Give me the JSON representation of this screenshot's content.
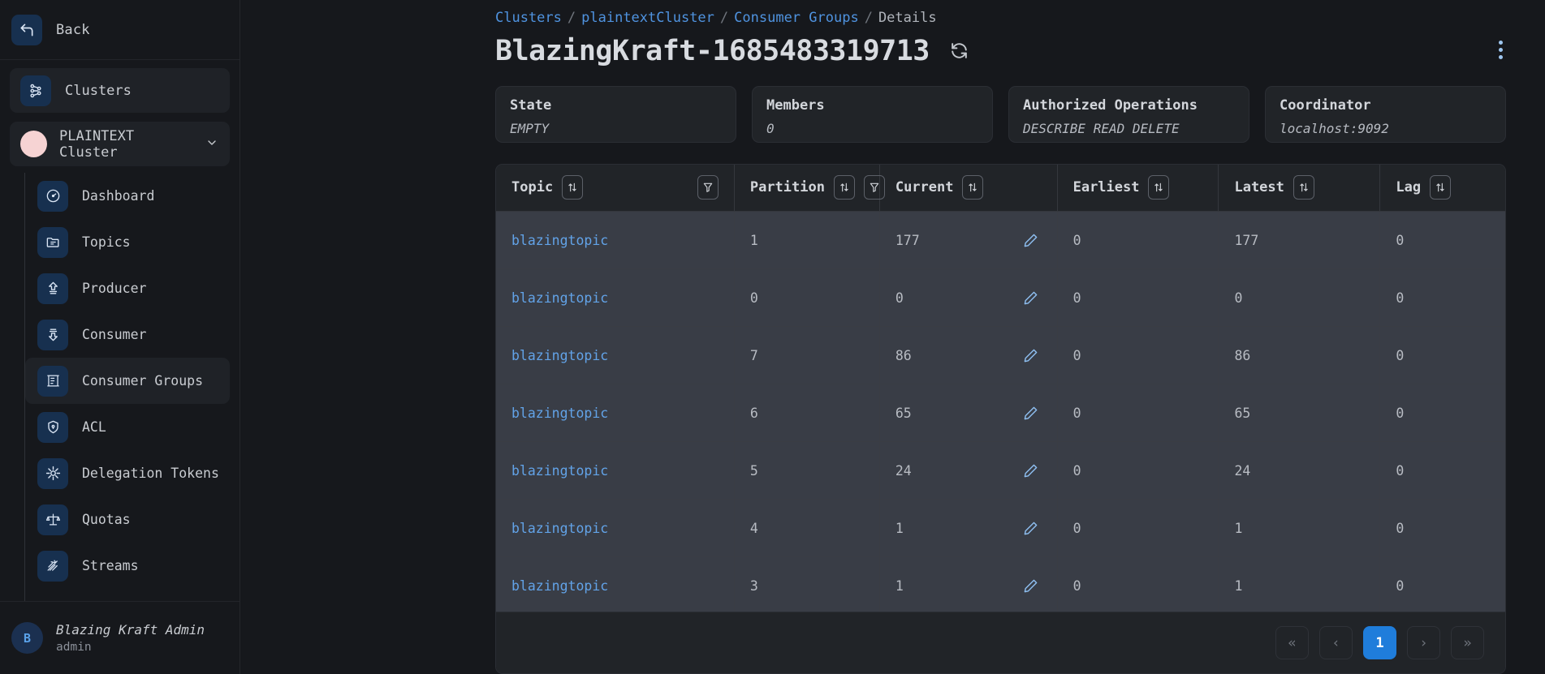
{
  "sidebar": {
    "back_label": "Back",
    "clusters_label": "Clusters",
    "cluster_selector": {
      "name": "PLAINTEXT Cluster"
    },
    "items": [
      {
        "label": "Dashboard",
        "icon": "gauge-icon",
        "active": false
      },
      {
        "label": "Topics",
        "icon": "folder-icon",
        "active": false
      },
      {
        "label": "Producer",
        "icon": "upload-icon",
        "active": false
      },
      {
        "label": "Consumer",
        "icon": "download-icon",
        "active": false
      },
      {
        "label": "Consumer Groups",
        "icon": "consumer-groups-icon",
        "active": true
      },
      {
        "label": "ACL",
        "icon": "shield-icon",
        "active": false
      },
      {
        "label": "Delegation Tokens",
        "icon": "asterisk-icon",
        "active": false
      },
      {
        "label": "Quotas",
        "icon": "scales-icon",
        "active": false
      },
      {
        "label": "Streams",
        "icon": "streams-icon",
        "active": false
      }
    ],
    "user": {
      "initial": "B",
      "name": "Blazing Kraft Admin",
      "role": "admin"
    }
  },
  "header": {
    "breadcrumb": [
      {
        "text": "Clusters",
        "link": true
      },
      {
        "text": "/",
        "link": false
      },
      {
        "text": "plaintextCluster",
        "link": true
      },
      {
        "text": "/",
        "link": false
      },
      {
        "text": "Consumer Groups",
        "link": true
      },
      {
        "text": "/",
        "link": false
      },
      {
        "text": "Details",
        "link": false
      }
    ],
    "title": "BlazingKraft-1685483319713",
    "refresh_icon": "refresh-icon",
    "menu_icon": "kebab-menu-icon"
  },
  "stats": [
    {
      "label": "State",
      "value": "EMPTY"
    },
    {
      "label": "Members",
      "value": "0"
    },
    {
      "label": "Authorized Operations",
      "value": "DESCRIBE READ DELETE"
    },
    {
      "label": "Coordinator",
      "value": "localhost:9092"
    }
  ],
  "table": {
    "columns": [
      {
        "label": "Topic",
        "sort": true,
        "filter": true
      },
      {
        "label": "Partition",
        "sort": true,
        "filter": true
      },
      {
        "label": "Current",
        "sort": true,
        "filter": false,
        "editable": true
      },
      {
        "label": "Earliest",
        "sort": true,
        "filter": false
      },
      {
        "label": "Latest",
        "sort": true,
        "filter": false
      },
      {
        "label": "Lag",
        "sort": true,
        "filter": false
      }
    ],
    "rows": [
      {
        "topic": "blazingtopic",
        "partition": "1",
        "current": "177",
        "earliest": "0",
        "latest": "177",
        "lag": "0"
      },
      {
        "topic": "blazingtopic",
        "partition": "0",
        "current": "0",
        "earliest": "0",
        "latest": "0",
        "lag": "0"
      },
      {
        "topic": "blazingtopic",
        "partition": "7",
        "current": "86",
        "earliest": "0",
        "latest": "86",
        "lag": "0"
      },
      {
        "topic": "blazingtopic",
        "partition": "6",
        "current": "65",
        "earliest": "0",
        "latest": "65",
        "lag": "0"
      },
      {
        "topic": "blazingtopic",
        "partition": "5",
        "current": "24",
        "earliest": "0",
        "latest": "24",
        "lag": "0"
      },
      {
        "topic": "blazingtopic",
        "partition": "4",
        "current": "1",
        "earliest": "0",
        "latest": "1",
        "lag": "0"
      },
      {
        "topic": "blazingtopic",
        "partition": "3",
        "current": "1",
        "earliest": "0",
        "latest": "1",
        "lag": "0"
      }
    ]
  },
  "pagination": {
    "first": "«",
    "prev": "‹",
    "current_page": "1",
    "next": "›",
    "last": "»"
  },
  "colors": {
    "accent": "#1f7ddb",
    "link": "#62a3e8",
    "page_bg": "#16181c",
    "row_bg": "#393d46"
  }
}
